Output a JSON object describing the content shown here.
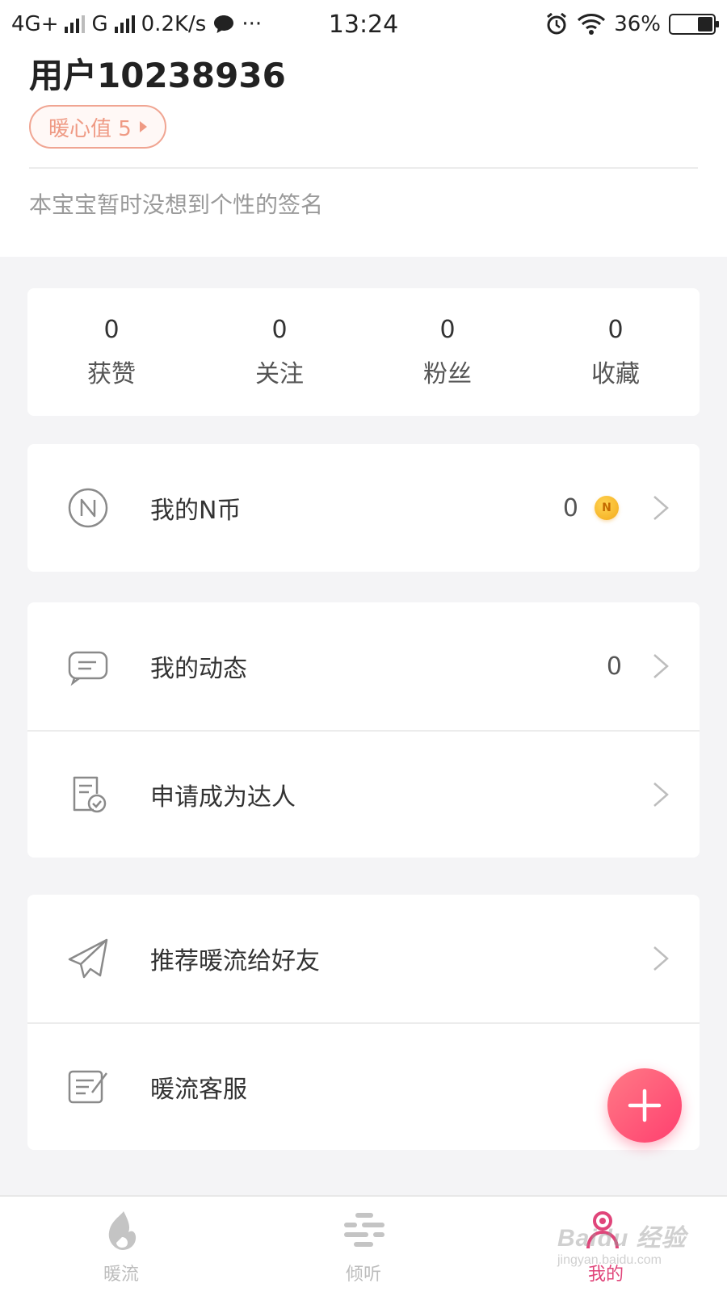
{
  "status_bar": {
    "network_1": "4G+",
    "network_2": "G",
    "speed": "0.2K/s",
    "dots": "···",
    "time": "13:24",
    "battery": "36%",
    "battery_level": 0.36
  },
  "profile": {
    "username": "用户10238936",
    "warm_badge": "暖心值 5",
    "signature": "本宝宝暂时没想到个性的签名"
  },
  "stats": [
    {
      "value": "0",
      "label": "获赞"
    },
    {
      "value": "0",
      "label": "关注"
    },
    {
      "value": "0",
      "label": "粉丝"
    },
    {
      "value": "0",
      "label": "收藏"
    }
  ],
  "menu": {
    "coins": {
      "label": "我的N币",
      "value": "0",
      "coin_glyph": "N"
    },
    "posts": {
      "label": "我的动态",
      "value": "0"
    },
    "apply": {
      "label": "申请成为达人"
    },
    "recommend": {
      "label": "推荐暖流给好友"
    },
    "service": {
      "label": "暖流客服"
    }
  },
  "tabs": [
    {
      "label": "暖流",
      "icon": "flame-icon",
      "active": false
    },
    {
      "label": "倾听",
      "icon": "listen-icon",
      "active": false
    },
    {
      "label": "我的",
      "icon": "profile-icon",
      "active": true
    }
  ],
  "watermark": {
    "main": "Baidu 经验",
    "sub": "jingyan.baidu.com"
  },
  "colors": {
    "accent": "#e0457a",
    "badge": "#ef9a84",
    "fab": "#ff4f75"
  }
}
